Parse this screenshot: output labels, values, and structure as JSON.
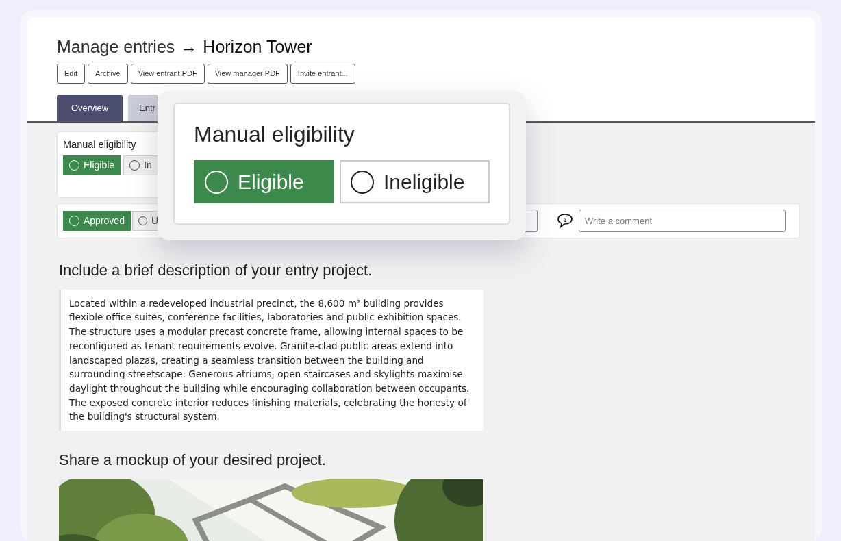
{
  "header": {
    "title": "Manage entries",
    "arrow": "→",
    "entry_name": "Horizon Tower"
  },
  "actions": [
    "Edit",
    "Archive",
    "View entrant PDF",
    "View manager PDF",
    "Invite entrant..."
  ],
  "tabs": [
    {
      "label": "Overview",
      "selected": true
    },
    {
      "label": "Entr",
      "selected": false
    }
  ],
  "eligibility": {
    "label": "Manual eligibility",
    "options": [
      {
        "label": "Eligible",
        "selected": true
      },
      {
        "label": "In",
        "selected": false
      }
    ]
  },
  "approval": {
    "options": [
      {
        "label": "Approved",
        "selected": true
      },
      {
        "label": "U",
        "selected": false
      }
    ],
    "comment": {
      "count": "1",
      "placeholder": "Write a comment"
    }
  },
  "questions": [
    {
      "prompt": "Include a brief description of your entry project.",
      "kind": "text",
      "answer": "Located within a redeveloped industrial precinct, the 8,600 m² building provides flexible office suites, conference facilities, laboratories and public exhibition spaces. The structure uses a modular precast concrete frame, allowing internal spaces to be reconfigured as tenant requirements evolve. Granite-clad public areas extend into landscaped plazas, creating a seamless transition between the building and surrounding streetscape. Generous atriums, open staircases and skylights maximise daylight throughout the building while encouraging collaboration between occupants. The exposed concrete interior reduces finishing materials, celebrating the honesty of the building's structural system."
    },
    {
      "prompt": "Share a mockup of your desired project.",
      "kind": "picture"
    }
  ],
  "callout": {
    "title": "Manual eligibility",
    "options": [
      {
        "label": "Eligible",
        "selected": true
      },
      {
        "label": "Ineligible",
        "selected": false
      }
    ]
  }
}
